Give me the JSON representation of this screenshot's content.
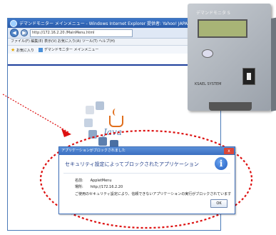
{
  "browser": {
    "title": "デマンドモニター メインメニュー - Windows Internet Explorer 提供者: Yahoo! JAPAN",
    "url": "http://172.16.2.20 /MainMenu.html",
    "menu_items": "ファイル(F) 編集(E) 表示(V) お気に入り(A) ツール(T) ヘルプ(H)",
    "favorites_label": "お気に入り",
    "tab_label": "デマンドモニター メインメニュー"
  },
  "java_loader": {
    "label": "Java"
  },
  "device": {
    "brand": "デマンドモニタ S",
    "lcd_text": "",
    "footer_label": "KSAEL SYSTEM"
  },
  "dialog": {
    "title": "アプリケーションがブロックされました",
    "heading": "セキュリティ設定によってブロックされたアプリケーション",
    "name_key": "名前:",
    "name_value": "AppletMenu",
    "location_key": "場所:",
    "location_value": "http://172.16.2.20",
    "message": "ご使用のセキュリティ設定により、信頼できないアプリケーションの実行がブロックされています",
    "ok_label": "OK",
    "close_label": "x"
  },
  "colors": {
    "highlight": "#dd1111",
    "dialog_accent": "#3c6db8"
  }
}
